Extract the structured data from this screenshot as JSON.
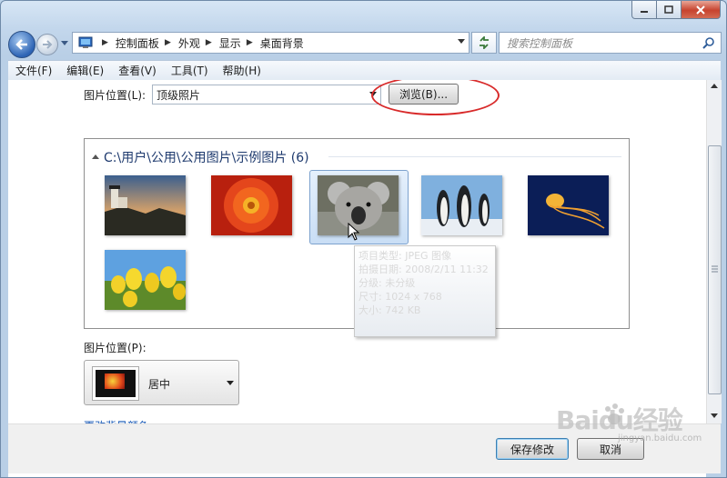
{
  "window": {
    "caption_buttons": [
      "minimize-icon",
      "maximize-icon",
      "close-icon"
    ]
  },
  "nav": {
    "breadcrumbs": [
      "控制面板",
      "外观",
      "显示",
      "桌面背景"
    ],
    "search_placeholder": "搜索控制面板"
  },
  "menu": [
    "文件(F)",
    "编辑(E)",
    "查看(V)",
    "工具(T)",
    "帮助(H)"
  ],
  "picture_location": {
    "label": "图片位置(L):",
    "value": "顶级照片",
    "browse_label": "浏览(B)..."
  },
  "gallery": {
    "group_title": "C:\\用户\\公用\\公用图片\\示例图片 (6)",
    "items": [
      "lighthouse",
      "chrysanthemum",
      "koala",
      "penguins",
      "jellyfish",
      "tulips"
    ],
    "selected_index": 2
  },
  "tooltip": {
    "lines": [
      "项目类型: JPEG 图像",
      "拍摄日期: 2008/2/11 11:32",
      "分级: 未分级",
      "尺寸: 1024 x 768",
      "大小: 742 KB"
    ]
  },
  "picture_position": {
    "label": "图片位置(P):",
    "value": "居中"
  },
  "change_color_link": "更改背景颜色",
  "footer": {
    "save_label": "保存修改",
    "cancel_label": "取消"
  },
  "watermark": {
    "text": "Baidu经验",
    "sub": "jingyan.baidu.com"
  },
  "colors": {
    "frame": "#bcd3ea",
    "highlight_ring": "#d82a2a",
    "link": "#1a5bb8",
    "selection": "#c9def5"
  }
}
